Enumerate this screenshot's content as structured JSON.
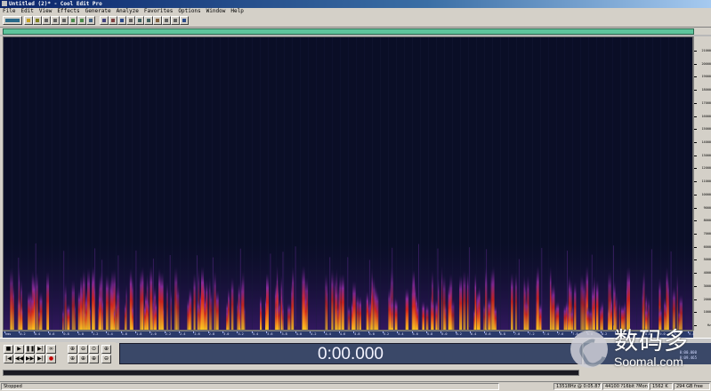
{
  "window": {
    "title": "Untitled (2)* - Cool Edit Pro"
  },
  "menu": {
    "items": [
      "File",
      "Edit",
      "View",
      "Effects",
      "Generate",
      "Analyze",
      "Favorites",
      "Options",
      "Window",
      "Help"
    ]
  },
  "colors": {
    "spectrogram_bg": "#0a0e26",
    "overview_bar": "#5ec49c",
    "time_display_bg": "#3a4868",
    "energy_high": "#ffd21e",
    "energy_mid": "#e8331a",
    "energy_low": "#7a2aa8"
  },
  "icons": {
    "toolbar": [
      "waveform-view-icon",
      "open-icon",
      "save-icon",
      "cut-icon",
      "copy-icon",
      "paste-icon",
      "undo-icon",
      "redo-icon",
      "zoom-icon",
      "select-icon",
      "mix-icon",
      "spectral-view-icon",
      "edit-mode-icon",
      "multitrack-icon",
      "loop-icon",
      "cue-icon",
      "marker-icon",
      "settings-icon",
      "help-icon"
    ]
  },
  "frequency_scale": {
    "labels": [
      "21000",
      "20000",
      "19000",
      "18000",
      "17000",
      "16000",
      "15000",
      "14000",
      "13000",
      "12000",
      "11000",
      "10000",
      "9000",
      "8000",
      "7000",
      "6000",
      "5000",
      "4000",
      "3000",
      "2000",
      "1000",
      "Hz"
    ]
  },
  "time_scale": {
    "labels": [
      "hms",
      "0.2",
      "0.4",
      "0.6",
      "0.8",
      "1.0",
      "1.2",
      "1.4",
      "1.6",
      "1.8",
      "2.0",
      "2.2",
      "2.4",
      "2.6",
      "2.8",
      "3.0",
      "3.2",
      "3.4",
      "3.6",
      "3.8",
      "4.0",
      "4.2",
      "4.4",
      "4.6",
      "4.8",
      "5.0",
      "5.2",
      "5.4",
      "5.6",
      "5.8",
      "6.0",
      "6.2",
      "6.4",
      "6.6",
      "6.8",
      "7.0",
      "7.2",
      "7.4",
      "7.6",
      "7.8",
      "8.0",
      "8.2",
      "8.4",
      "8.6",
      "8.8",
      "9.0",
      "9.2",
      "9.4"
    ]
  },
  "transport": {
    "buttons": [
      "stop",
      "play",
      "pause",
      "play-to-end",
      "loop",
      "play-looped",
      "go-to-start",
      "rewind",
      "fast-forward",
      "go-to-end",
      "record"
    ],
    "zoom_buttons": [
      "zoom-in-horizontal",
      "zoom-out-horizontal",
      "zoom-full",
      "zoom-in-left",
      "zoom-in-right",
      "zoom-selection",
      "zoom-in-vertical",
      "zoom-out-vertical"
    ]
  },
  "time_display": {
    "value": "0:00.000"
  },
  "selection": {
    "begin": "0:00.000",
    "end": "0:09.465"
  },
  "status": {
    "state": "Stopped",
    "info": "13518Hz @ 0:05.871",
    "format": "44100 ?16bit ?Mono",
    "size": "1562 K",
    "free": "294 GB free"
  },
  "watermark": {
    "cn": "数码多",
    "en": "Soomal.com"
  }
}
